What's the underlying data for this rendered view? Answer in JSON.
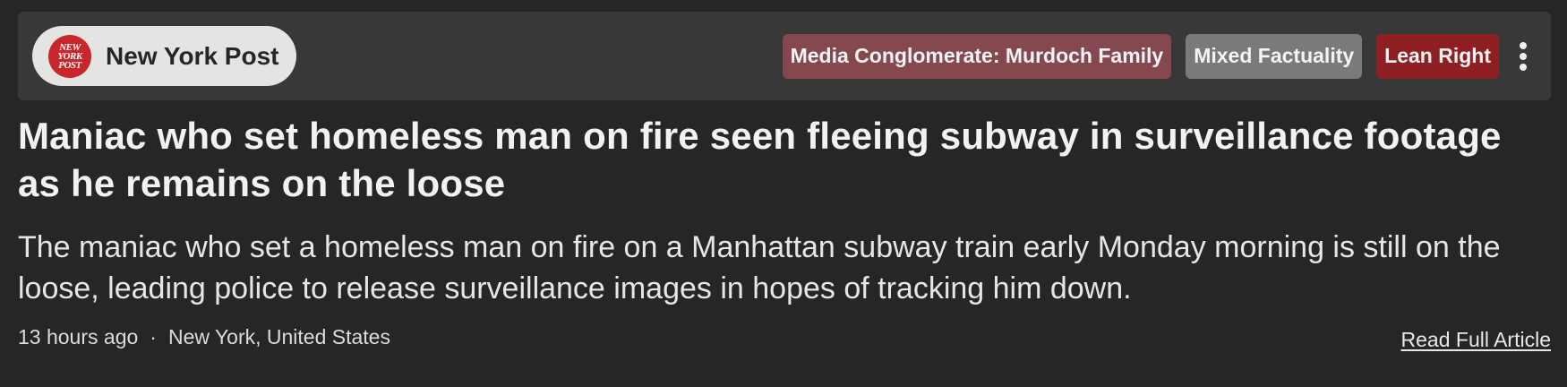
{
  "source": {
    "name": "New York Post",
    "logo_lines": [
      "NEW",
      "YORK",
      "POST"
    ],
    "logo_color": "#c8262b"
  },
  "badges": {
    "owner": {
      "label": "Media Conglomerate: Murdoch Family",
      "color": "#85484f"
    },
    "factuality": {
      "label": "Mixed Factuality",
      "color": "#7a7a7a"
    },
    "bias": {
      "label": "Lean Right",
      "color": "#8e1f22"
    }
  },
  "more_menu_icon": "vertical-ellipsis",
  "article": {
    "headline": "Maniac who set homeless man on fire seen fleeing subway in surveillance footage as he remains on the loose",
    "summary": "The maniac who set a homeless man on fire on a Manhattan subway train early Monday morning is still on the loose, leading police to release surveillance images in hopes of tracking him down.",
    "time": "13 hours ago",
    "separator": "·",
    "location": "New York, United States",
    "read_link": "Read Full Article"
  }
}
